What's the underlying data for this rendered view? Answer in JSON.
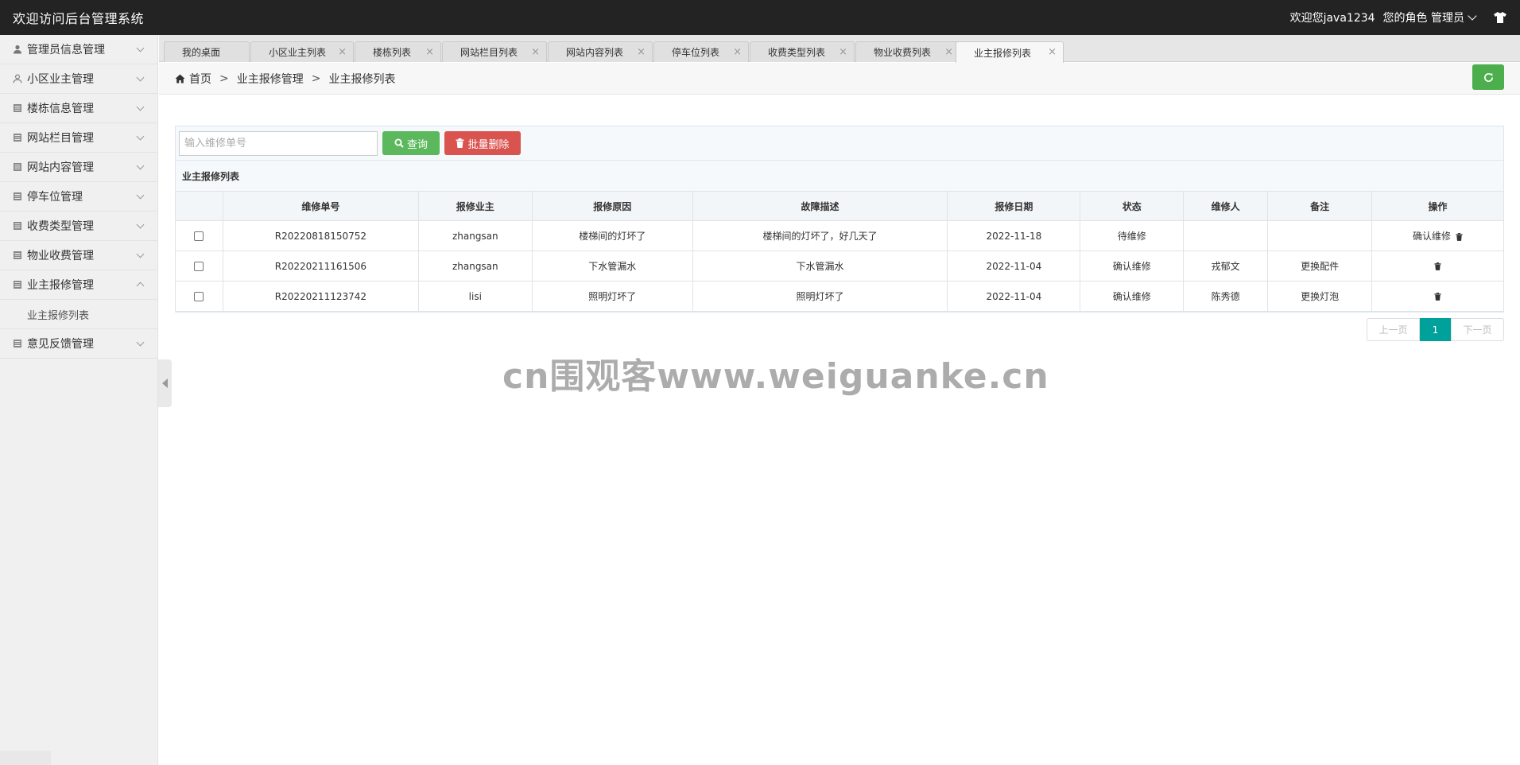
{
  "header": {
    "title": "欢迎访问后台管理系统",
    "welcome": "欢迎您java1234",
    "role": "您的角色 管理员"
  },
  "sidebar": {
    "items": [
      {
        "label": "管理员信息管理",
        "icon": "user-icon"
      },
      {
        "label": "小区业主管理",
        "icon": "user-outline-icon"
      },
      {
        "label": "楼栋信息管理",
        "icon": "list-icon"
      },
      {
        "label": "网站栏目管理",
        "icon": "list-icon"
      },
      {
        "label": "网站内容管理",
        "icon": "list-icon"
      },
      {
        "label": "停车位管理",
        "icon": "list-icon"
      },
      {
        "label": "收费类型管理",
        "icon": "list-icon"
      },
      {
        "label": "物业收费管理",
        "icon": "list-icon"
      },
      {
        "label": "业主报修管理",
        "icon": "list-icon",
        "expanded": true
      },
      {
        "label": "意见反馈管理",
        "icon": "list-icon"
      }
    ],
    "submenu": {
      "label": "业主报修列表"
    }
  },
  "tabs": [
    {
      "label": "我的桌面"
    },
    {
      "label": "小区业主列表"
    },
    {
      "label": "楼栋列表"
    },
    {
      "label": "网站栏目列表"
    },
    {
      "label": "网站内容列表"
    },
    {
      "label": "停车位列表"
    },
    {
      "label": "收费类型列表"
    },
    {
      "label": "物业收费列表"
    },
    {
      "label": "业主报修列表",
      "active": true
    }
  ],
  "breadcrumb": {
    "home": "首页",
    "sep": ">",
    "level1": "业主报修管理",
    "level2": "业主报修列表"
  },
  "search": {
    "placeholder": "输入维修单号",
    "query_label": "查询",
    "batch_delete_label": "批量删除"
  },
  "list_title": "业主报修列表",
  "table": {
    "columns": [
      "维修单号",
      "报修业主",
      "报修原因",
      "故障描述",
      "报修日期",
      "状态",
      "维修人",
      "备注",
      "操作"
    ],
    "rows": [
      {
        "no": "R20220818150752",
        "owner": "zhangsan",
        "reason": "楼梯间的灯坏了",
        "desc": "楼梯间的灯坏了，好几天了",
        "date": "2022-11-18",
        "status": "待维修",
        "repairer": "",
        "remark": "",
        "action": "确认维修"
      },
      {
        "no": "R20220211161506",
        "owner": "zhangsan",
        "reason": "下水管漏水",
        "desc": "下水管漏水",
        "date": "2022-11-04",
        "status": "确认维修",
        "repairer": "戎郁文",
        "remark": "更换配件",
        "action": ""
      },
      {
        "no": "R20220211123742",
        "owner": "lisi",
        "reason": "照明灯坏了",
        "desc": "照明灯坏了",
        "date": "2022-11-04",
        "status": "确认维修",
        "repairer": "陈秀德",
        "remark": "更换灯泡",
        "action": ""
      }
    ]
  },
  "pagination": {
    "prev": "上一页",
    "current": "1",
    "next": "下一页"
  },
  "watermark": "cn围观客www.weiguanke.cn",
  "colors": {
    "header_bg": "#232323",
    "refresh_green": "#4cae4c",
    "query_green": "#5cb85c",
    "delete_red": "#d9534f",
    "page_active": "#00a19a"
  }
}
